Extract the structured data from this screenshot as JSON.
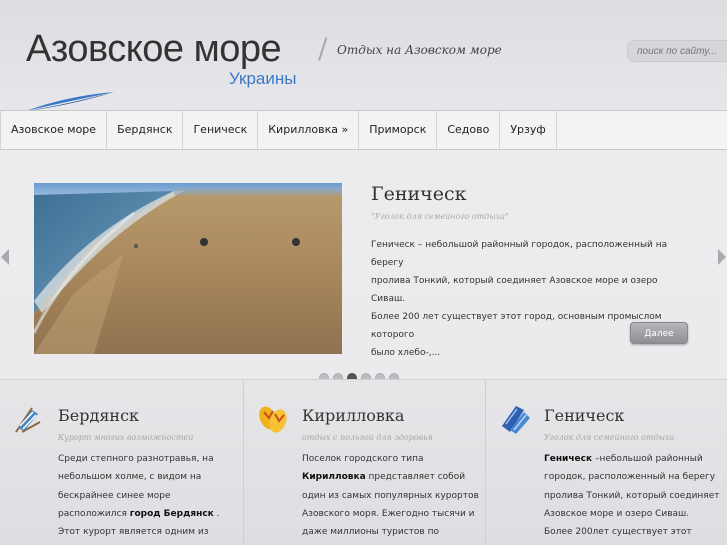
{
  "header": {
    "logo_title": "Азовское море",
    "logo_subtitle": "Украины",
    "tagline": "Отдых на Азовском море",
    "search_placeholder": "поиск по сайту..."
  },
  "nav": {
    "items": [
      "Азовское море",
      "Бердянск",
      "Геническ",
      "Кирилловка »",
      "Приморск",
      "Седово",
      "Урзуф"
    ]
  },
  "featured": {
    "title": "Геническ",
    "subtitle": "\"Уголок для семейного отдыха\"",
    "lines": [
      "Геническ – небольшой районный городок, расположенный на берегу",
      "пролива Тонкий, который соединяет Азовское море и озеро Сиваш.",
      "Более 200 лет существует этот город, основным промыслом которого",
      "было хлебо-,..."
    ],
    "more_label": "Далее",
    "slide_count": 6,
    "active_slide": 2
  },
  "columns": [
    {
      "icon": "beach-chair-icon",
      "title": "Бердянск",
      "subtitle": "Курорт многих возможностей",
      "lines": [
        "Среди степного разнотравья, на",
        "небольшом холме, с видом на",
        "бескрайнее синее море",
        "расположился город Бердянск .",
        "Этот курорт является одним из"
      ]
    },
    {
      "icon": "flip-flops-icon",
      "title": "Кирилловка",
      "subtitle": "отдых с пользой для здоровья",
      "lines": [
        "Поселок городского типа",
        "Кирилловка представляет собой",
        "один из самых популярных курортов",
        "Азовского моря.  Ежегодно тысячи и",
        "даже миллионы туристов  по"
      ]
    },
    {
      "icon": "flippers-icon",
      "title": "Геническ",
      "subtitle": "Уголок для семейного отдыха",
      "lines": [
        "Геническ  –небольшой районный",
        "городок, расположенный на берегу",
        "пролива Тонкий, который соединяет",
        "Азовское море и озеро Сиваш.",
        "Более  200лет существует этот"
      ]
    }
  ],
  "colors": {
    "accent_blue": "#3a78c8",
    "button_gray": "#9a9ba0"
  }
}
